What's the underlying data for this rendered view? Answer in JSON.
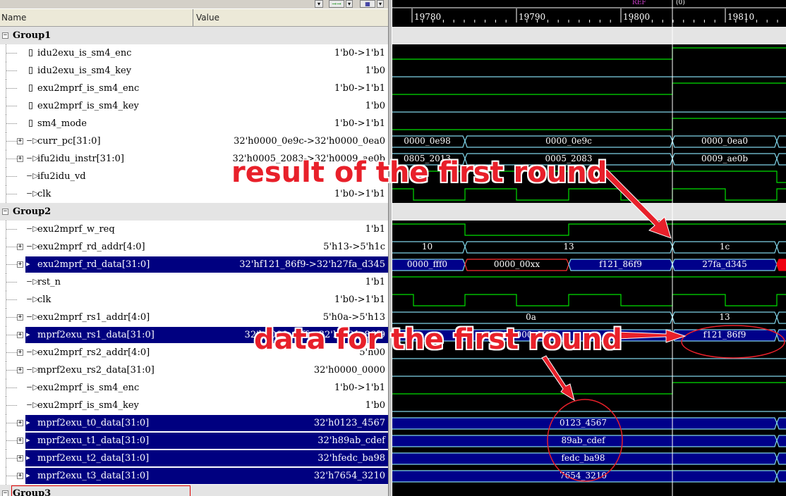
{
  "header": {
    "name_col": "Name",
    "value_col": "Value",
    "ref_label": "REF",
    "cursor_label": "(0)"
  },
  "timeline": {
    "ticks": [
      "19780",
      "19790",
      "19800",
      "19810"
    ]
  },
  "rows": [
    {
      "kind": "group",
      "name": "Group1"
    },
    {
      "kind": "sig",
      "name": "idu2exu_is_sm4_enc",
      "value": "1'b0->1'b1",
      "icon": "wire",
      "indent": 1
    },
    {
      "kind": "sig",
      "name": "idu2exu_is_sm4_key",
      "value": "1'b0",
      "icon": "wire",
      "indent": 1
    },
    {
      "kind": "sig",
      "name": "exu2mprf_is_sm4_enc",
      "value": "1'b0->1'b1",
      "icon": "wire",
      "indent": 1
    },
    {
      "kind": "sig",
      "name": "exu2mprf_is_sm4_key",
      "value": "1'b0",
      "icon": "wire",
      "indent": 1
    },
    {
      "kind": "sig",
      "name": "sm4_mode",
      "value": "1'b0->1'b1",
      "icon": "wire",
      "indent": 1
    },
    {
      "kind": "sig",
      "name": "curr_pc[31:0]",
      "value": "32'h0000_0e9c->32'h0000_0ea0",
      "icon": "port",
      "expand": true
    },
    {
      "kind": "sig",
      "name": "ifu2idu_instr[31:0]",
      "value": "32'h0005_2083->32'h0009_ae0b",
      "icon": "port",
      "expand": true
    },
    {
      "kind": "sig",
      "name": "ifu2idu_vd",
      "value": "",
      "icon": "port"
    },
    {
      "kind": "sig",
      "name": "clk",
      "value": "1'b0->1'b1",
      "icon": "port"
    },
    {
      "kind": "group",
      "name": "Group2"
    },
    {
      "kind": "sig",
      "name": "exu2mprf_w_req",
      "value": "1'b1",
      "icon": "port"
    },
    {
      "kind": "sig",
      "name": "exu2mprf_rd_addr[4:0]",
      "value": "5'h13->5'h1c",
      "icon": "port",
      "expand": true
    },
    {
      "kind": "sig",
      "name": "exu2mprf_rd_data[31:0]",
      "value": "32'hf121_86f9->32'h27fa_d345",
      "icon": "port",
      "expand": true,
      "sel": true
    },
    {
      "kind": "sig",
      "name": "rst_n",
      "value": "1'b1",
      "icon": "port"
    },
    {
      "kind": "sig",
      "name": "clk",
      "value": "1'b0->1'b1",
      "icon": "port"
    },
    {
      "kind": "sig",
      "name": "exu2mprf_rs1_addr[4:0]",
      "value": "5'h0a->5'h13",
      "icon": "port",
      "expand": true
    },
    {
      "kind": "sig",
      "name": "mprf2exu_rs1_data[31:0]",
      "value": "32'h0000_0fff->32'hf121_86f9",
      "icon": "port",
      "expand": true,
      "sel": true
    },
    {
      "kind": "sig",
      "name": "exu2mprf_rs2_addr[4:0]",
      "value": "5'h00",
      "icon": "port",
      "expand": true
    },
    {
      "kind": "sig",
      "name": "mprf2exu_rs2_data[31:0]",
      "value": "32'h0000_0000",
      "icon": "port",
      "expand": true
    },
    {
      "kind": "sig",
      "name": "exu2mprf_is_sm4_enc",
      "value": "1'b0->1'b1",
      "icon": "port"
    },
    {
      "kind": "sig",
      "name": "exu2mprf_is_sm4_key",
      "value": "1'b0",
      "icon": "port"
    },
    {
      "kind": "sig",
      "name": "mprf2exu_t0_data[31:0]",
      "value": "32'h0123_4567",
      "icon": "port",
      "expand": true,
      "sel": true
    },
    {
      "kind": "sig",
      "name": "mprf2exu_t1_data[31:0]",
      "value": "32'h89ab_cdef",
      "icon": "port",
      "expand": true,
      "sel": true
    },
    {
      "kind": "sig",
      "name": "mprf2exu_t2_data[31:0]",
      "value": "32'hfedc_ba98",
      "icon": "port",
      "expand": true,
      "sel": true
    },
    {
      "kind": "sig",
      "name": "mprf2exu_t3_data[31:0]",
      "value": "32'h7654_3210",
      "icon": "port",
      "expand": true,
      "sel": true
    },
    {
      "kind": "group",
      "name": "Group3"
    }
  ],
  "bus_labels": {
    "curr_pc": [
      "0000_0e98",
      "0000_0e9c",
      "0000_0ea0"
    ],
    "ifu2idu_instr": [
      "0805_2013",
      "0005_2083",
      "0009_ae0b"
    ],
    "rd_addr": [
      "10",
      "13",
      "1c"
    ],
    "rd_data": [
      "0000_fff0",
      "0000_00xx",
      "f121_86f9",
      "27fa_d345"
    ],
    "rs1_addr": [
      "0a",
      "13"
    ],
    "rs1_data": [
      "0000_0fff",
      "f121_86f9"
    ],
    "t0": "0123_4567",
    "t1": "89ab_cdef",
    "t2": "fedc_ba98",
    "t3": "7654_3210"
  },
  "annotations": {
    "result": "result of the first round",
    "data": "data for the first round"
  },
  "colors": {
    "wave_green": "#00e000",
    "wave_cyan": "#7fd4e8",
    "bus_blue": "#00008a",
    "annot_red": "#e8202a",
    "select_navy": "#000080"
  }
}
